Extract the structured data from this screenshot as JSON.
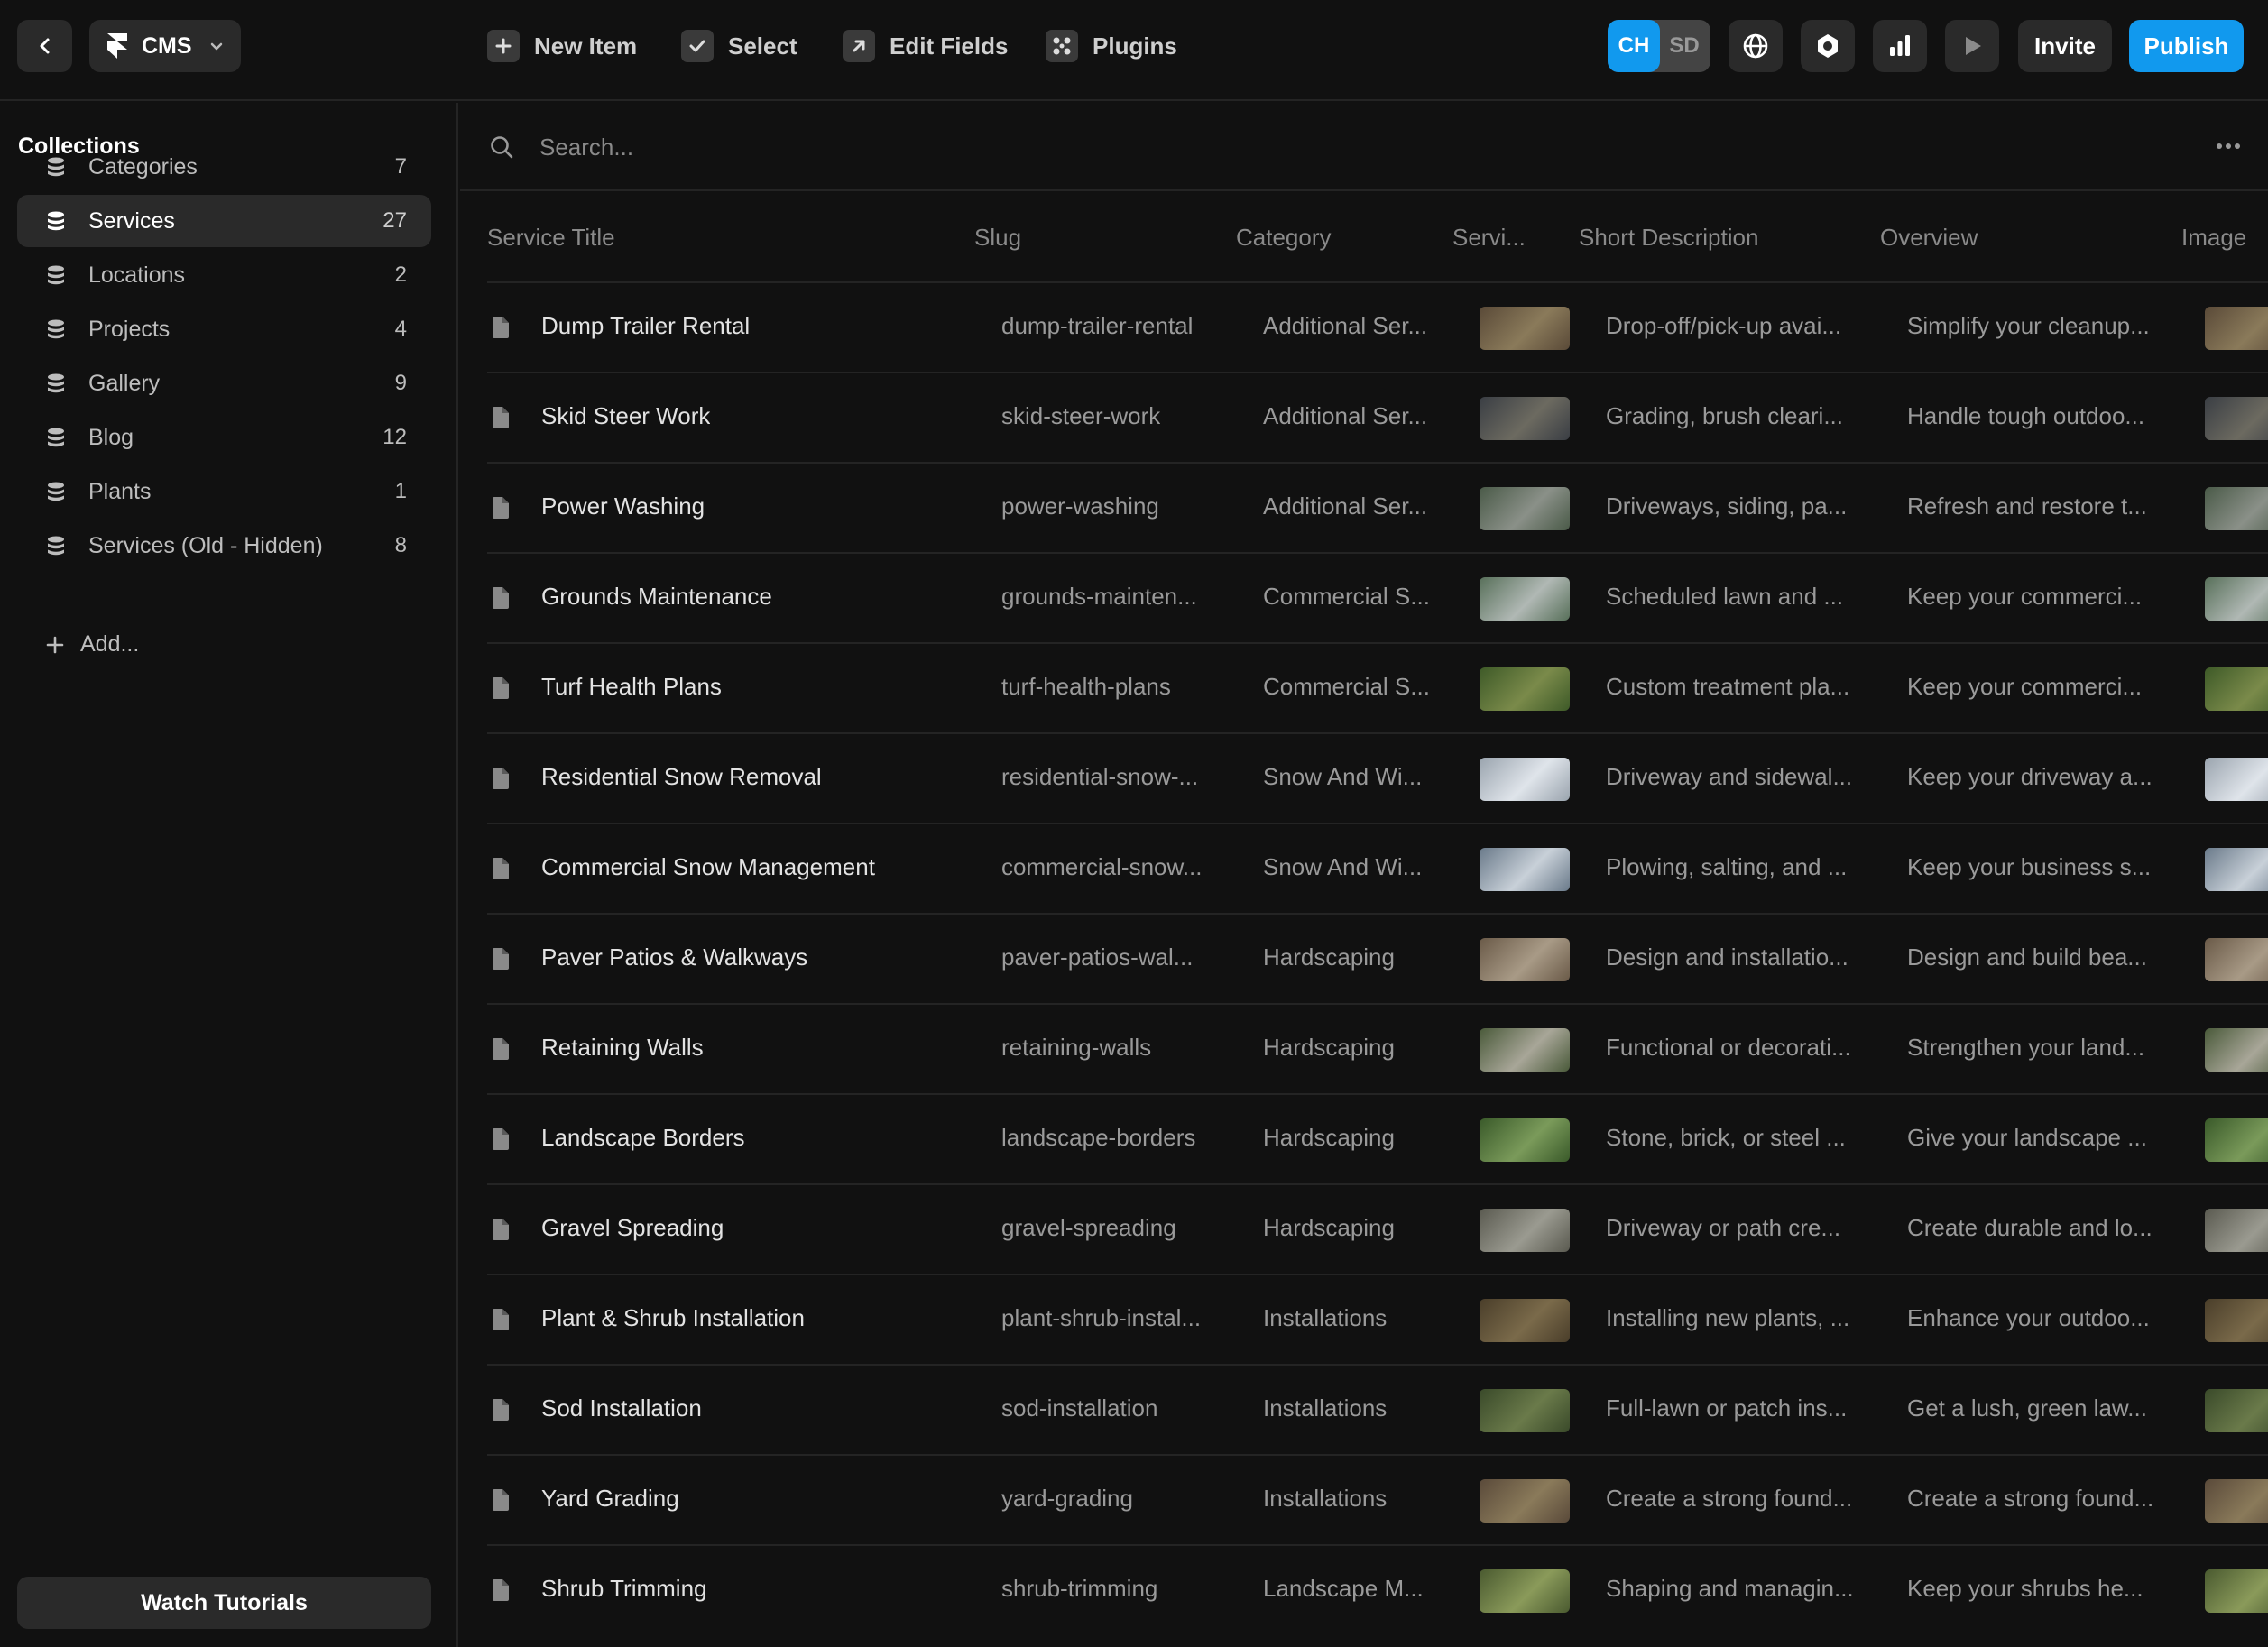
{
  "topbar": {
    "cms_label": "CMS",
    "tools": [
      {
        "label": "New Item",
        "icon": "plus-square-icon"
      },
      {
        "label": "Select",
        "icon": "checkbox-icon"
      },
      {
        "label": "Edit Fields",
        "icon": "arrow-up-right-icon"
      },
      {
        "label": "Plugins",
        "icon": "plugins-icon"
      }
    ],
    "avatars": [
      "CH",
      "SD"
    ],
    "invite_label": "Invite",
    "publish_label": "Publish",
    "accent_color": "#1199ee"
  },
  "sidebar": {
    "title": "Collections",
    "items": [
      {
        "label": "Categories",
        "count": "7"
      },
      {
        "label": "Services",
        "count": "27",
        "active": true
      },
      {
        "label": "Locations",
        "count": "2"
      },
      {
        "label": "Projects",
        "count": "4"
      },
      {
        "label": "Gallery",
        "count": "9"
      },
      {
        "label": "Blog",
        "count": "12"
      },
      {
        "label": "Plants",
        "count": "1"
      },
      {
        "label": "Services (Old - Hidden)",
        "count": "8"
      }
    ],
    "add_label": "Add...",
    "watch_label": "Watch Tutorials"
  },
  "search": {
    "placeholder": "Search..."
  },
  "table": {
    "headers": [
      "Service Title",
      "Slug",
      "Category",
      "Servi...",
      "Short Description",
      "Overview",
      "Image"
    ],
    "rows": [
      {
        "title": "Dump Trailer Rental",
        "slug": "dump-trailer-rental",
        "category": "Additional Ser...",
        "short": "Drop-off/pick-up avai...",
        "overview": "Simplify your cleanup...",
        "thumb": [
          "#5a4a38",
          "#8a7a5a"
        ]
      },
      {
        "title": "Skid Steer Work",
        "slug": "skid-steer-work",
        "category": "Additional Ser...",
        "short": "Grading, brush cleari...",
        "overview": "Handle tough outdoo...",
        "thumb": [
          "#3a3e44",
          "#6c6a60"
        ]
      },
      {
        "title": "Power Washing",
        "slug": "power-washing",
        "category": "Additional Ser...",
        "short": "Driveways, siding, pa...",
        "overview": "Refresh and restore t...",
        "thumb": [
          "#4a5a48",
          "#8a9088"
        ]
      },
      {
        "title": "Grounds Maintenance",
        "slug": "grounds-mainten...",
        "category": "Commercial S...",
        "short": "Scheduled lawn and ...",
        "overview": "Keep your commerci...",
        "thumb": [
          "#58705a",
          "#b0b8b4"
        ]
      },
      {
        "title": "Turf Health Plans",
        "slug": "turf-health-plans",
        "category": "Commercial S...",
        "short": "Custom treatment pla...",
        "overview": "Keep your commerci...",
        "thumb": [
          "#3e5a28",
          "#7a8a4a"
        ]
      },
      {
        "title": "Residential Snow Removal",
        "slug": "residential-snow-...",
        "category": "Snow And Wi...",
        "short": "Driveway and sidewal...",
        "overview": "Keep your driveway a...",
        "thumb": [
          "#9aa4ae",
          "#dfe4ea"
        ]
      },
      {
        "title": "Commercial Snow Management",
        "slug": "commercial-snow...",
        "category": "Snow And Wi...",
        "short": "Plowing, salting, and ...",
        "overview": "Keep your business s...",
        "thumb": [
          "#6a7a8a",
          "#c8d0d8"
        ]
      },
      {
        "title": "Paver Patios & Walkways",
        "slug": "paver-patios-wal...",
        "category": "Hardscaping",
        "short": "Design and installatio...",
        "overview": "Design and build bea...",
        "thumb": [
          "#6a5a48",
          "#a89a86"
        ]
      },
      {
        "title": "Retaining Walls",
        "slug": "retaining-walls",
        "category": "Hardscaping",
        "short": "Functional or decorati...",
        "overview": "Strengthen your land...",
        "thumb": [
          "#4a5a3a",
          "#a8a698"
        ]
      },
      {
        "title": "Landscape Borders",
        "slug": "landscape-borders",
        "category": "Hardscaping",
        "short": "Stone, brick, or steel ...",
        "overview": "Give your landscape ...",
        "thumb": [
          "#3a5a2a",
          "#7a9a5a"
        ]
      },
      {
        "title": "Gravel Spreading",
        "slug": "gravel-spreading",
        "category": "Hardscaping",
        "short": "Driveway or path cre...",
        "overview": "Create durable and lo...",
        "thumb": [
          "#5a5a50",
          "#9a9a90"
        ]
      },
      {
        "title": "Plant & Shrub Installation",
        "slug": "plant-shrub-instal...",
        "category": "Installations",
        "short": "Installing new plants, ...",
        "overview": "Enhance your outdoo...",
        "thumb": [
          "#4a3e2a",
          "#7a6a4a"
        ]
      },
      {
        "title": "Sod Installation",
        "slug": "sod-installation",
        "category": "Installations",
        "short": "Full-lawn or patch ins...",
        "overview": "Get a lush, green law...",
        "thumb": [
          "#3a4a2a",
          "#6a7a4a"
        ]
      },
      {
        "title": "Yard Grading",
        "slug": "yard-grading",
        "category": "Installations",
        "short": "Create a strong found...",
        "overview": "Create a strong found...",
        "thumb": [
          "#5a4a3a",
          "#8a7a5a"
        ]
      },
      {
        "title": "Shrub Trimming",
        "slug": "shrub-trimming",
        "category": "Landscape M...",
        "short": "Shaping and managin...",
        "overview": "Keep your shrubs he...",
        "thumb": [
          "#4a5a30",
          "#8a9a5a"
        ]
      }
    ]
  }
}
